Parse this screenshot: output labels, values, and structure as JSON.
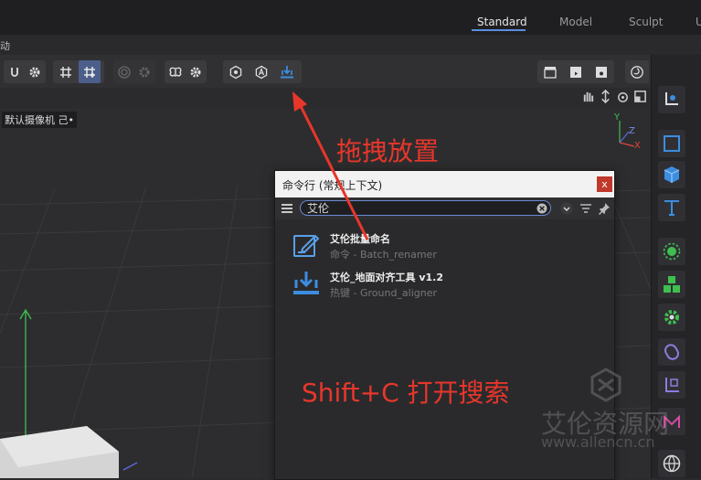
{
  "layouts": {
    "standard": "Standard",
    "model": "Model",
    "sculpt": "Sculpt",
    "partial": "U"
  },
  "menu": {
    "partial_item": "动"
  },
  "viewport": {
    "camera": "默认摄像机 己•"
  },
  "axis_gizmo": {
    "y": "Y",
    "z": "Z",
    "x": "X"
  },
  "command_dialog": {
    "title": "命令行 (常规上下文)",
    "close_label": "x",
    "search_value": "艾伦",
    "results": [
      {
        "name": "艾伦批量命名",
        "sub": "命令 - Batch_renamer",
        "icon": "edit-document-icon"
      },
      {
        "name": "艾伦_地面对齐工具 v1.2",
        "sub": "热键 - Ground_aligner",
        "icon": "ground-align-icon"
      }
    ]
  },
  "annotations": {
    "drag": "拖拽放置",
    "shortcut": "Shift+C 打开搜索"
  },
  "watermark": {
    "cn": "艾伦资源网",
    "url": "www.allencn.cn"
  },
  "colors": {
    "accent": "#5b8de0",
    "annotation": "#e8362b",
    "close": "#c0392b",
    "icon_blue": "#3c8de0",
    "icon_green": "#3fbf4f"
  }
}
